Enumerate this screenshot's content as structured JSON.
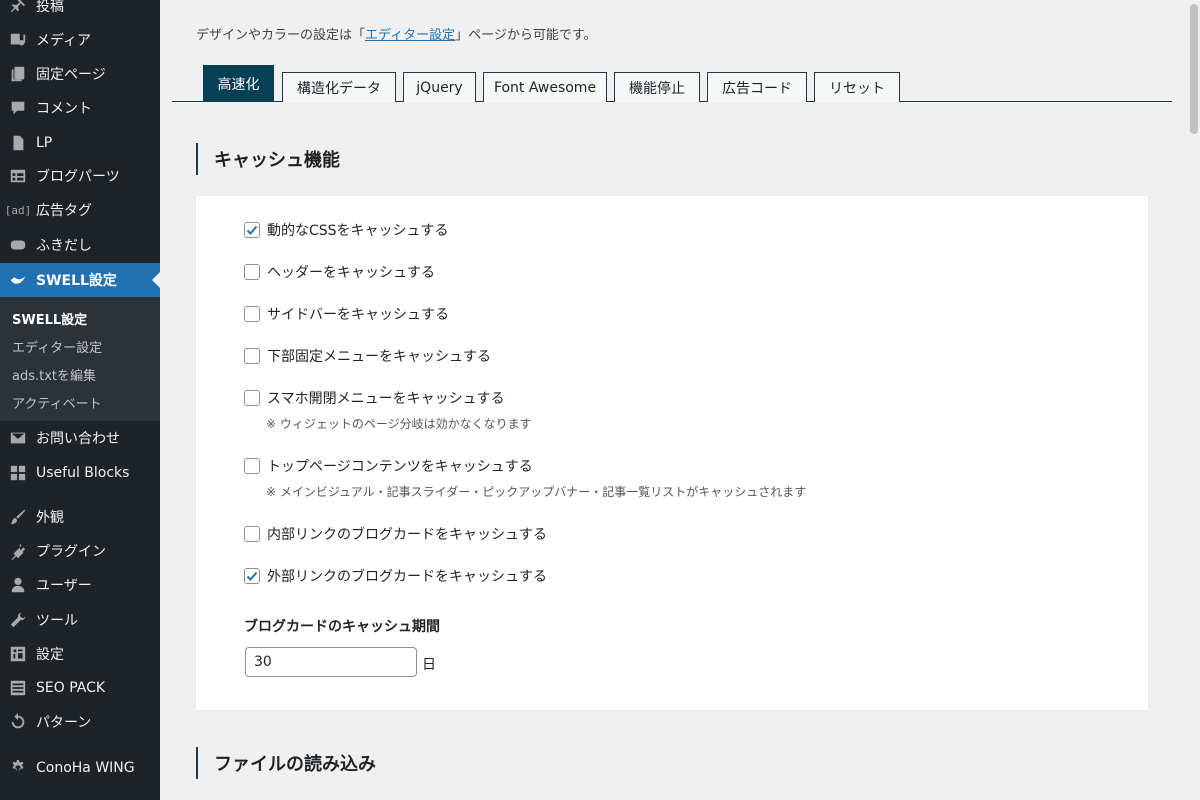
{
  "sidebar": {
    "items": [
      {
        "label": "投稿",
        "icon": "pin-icon"
      },
      {
        "label": "メディア",
        "icon": "media-icon"
      },
      {
        "label": "固定ページ",
        "icon": "page-icon"
      },
      {
        "label": "コメント",
        "icon": "comment-icon"
      },
      {
        "label": "LP",
        "icon": "document-icon"
      },
      {
        "label": "ブログパーツ",
        "icon": "table-icon"
      },
      {
        "label": "広告タグ",
        "icon": "ad-icon",
        "icon_text": "[ad]"
      },
      {
        "label": "ふきだし",
        "icon": "speech-bubble-icon"
      },
      {
        "label": "SWELL設定",
        "icon": "swell-icon"
      },
      {
        "label": "お問い合わせ",
        "icon": "mail-icon"
      },
      {
        "label": "Useful Blocks",
        "icon": "grid-icon"
      },
      {
        "label": "外観",
        "icon": "brush-icon"
      },
      {
        "label": "プラグイン",
        "icon": "plugin-icon"
      },
      {
        "label": "ユーザー",
        "icon": "user-icon"
      },
      {
        "label": "ツール",
        "icon": "wrench-icon"
      },
      {
        "label": "設定",
        "icon": "settings-icon"
      },
      {
        "label": "SEO PACK",
        "icon": "list-icon"
      },
      {
        "label": "パターン",
        "icon": "undo-icon"
      },
      {
        "label": "ConoHa WING",
        "icon": "gear-icon"
      }
    ],
    "submenu": [
      "SWELL設定",
      "エディター設定",
      "ads.txtを編集",
      "アクティベート"
    ]
  },
  "intro": {
    "before": "デザインやカラーの設定は「",
    "link": "エディター設定",
    "after": "」ページから可能です。"
  },
  "tabs": [
    "高速化",
    "構造化データ",
    "jQuery",
    "Font Awesome",
    "機能停止",
    "広告コード",
    "リセット"
  ],
  "section1": {
    "title": "キャッシュ機能",
    "options": [
      {
        "label": "動的なCSSをキャッシュする",
        "checked": true
      },
      {
        "label": "ヘッダーをキャッシュする",
        "checked": false
      },
      {
        "label": "サイドバーをキャッシュする",
        "checked": false
      },
      {
        "label": "下部固定メニューをキャッシュする",
        "checked": false
      },
      {
        "label": "スマホ開閉メニューをキャッシュする",
        "checked": false,
        "note": "※ ウィジェットのページ分岐は効かなくなります"
      },
      {
        "label": "トップページコンテンツをキャッシュする",
        "checked": false,
        "note": "※ メインビジュアル・記事スライダー・ピックアップバナー・記事一覧リストがキャッシュされます"
      },
      {
        "label": "内部リンクのブログカードをキャッシュする",
        "checked": false
      },
      {
        "label": "外部リンクのブログカードをキャッシュする",
        "checked": true
      }
    ],
    "period_label": "ブログカードのキャッシュ期間",
    "period_value": "30",
    "period_unit": "日"
  },
  "section2": {
    "title": "ファイルの読み込み"
  },
  "colors": {
    "sidebar": "#1d2327",
    "active": "#2271b1",
    "tab_active": "#073f55",
    "link": "#2271b1"
  }
}
